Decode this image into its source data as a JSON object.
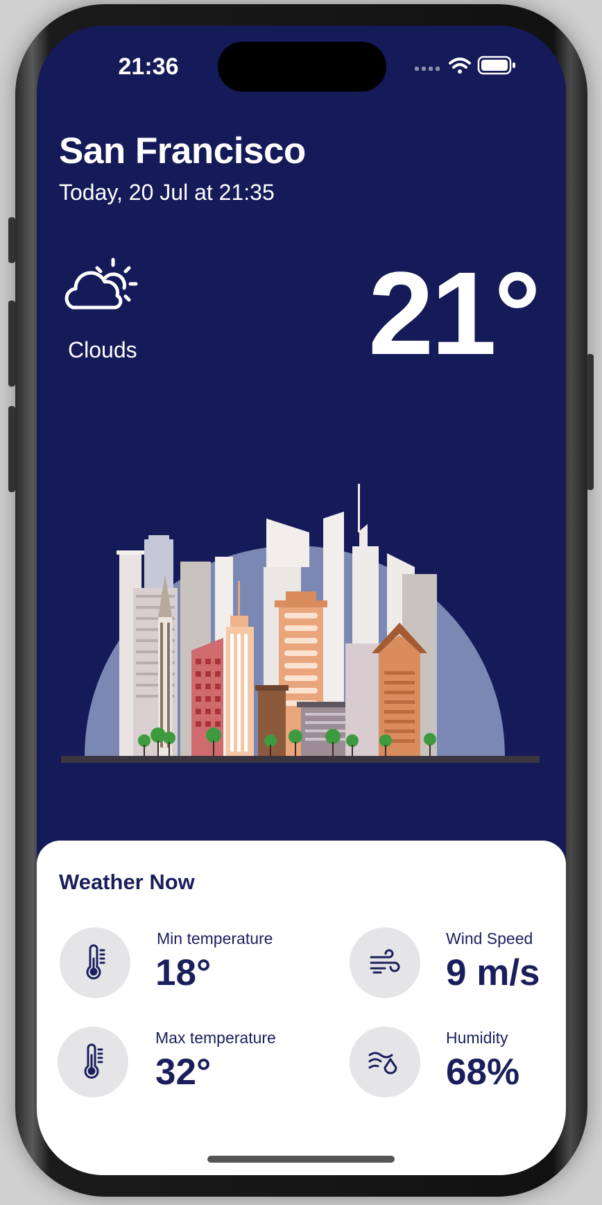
{
  "status_bar": {
    "time": "21:36"
  },
  "header": {
    "city": "San Francisco",
    "date": "Today, 20 Jul at 21:35"
  },
  "current": {
    "condition": "Clouds",
    "condition_icon": "cloud-sun-icon",
    "temperature": "21°"
  },
  "weather_now": {
    "title": "Weather Now",
    "metrics": [
      {
        "label": "Min temperature",
        "value": "18°",
        "icon": "thermometer-icon"
      },
      {
        "label": "Wind Speed",
        "value": "9 m/s",
        "icon": "wind-icon"
      },
      {
        "label": "Max temperature",
        "value": "32°",
        "icon": "thermometer-icon"
      },
      {
        "label": "Humidity",
        "value": "68%",
        "icon": "humidity-icon"
      }
    ]
  },
  "colors": {
    "background": "#151a58",
    "card": "#ffffff",
    "accent_text": "#1a1f5c",
    "icon_circle": "#e5e5e8",
    "skyline_dome": "#7b88b3"
  }
}
